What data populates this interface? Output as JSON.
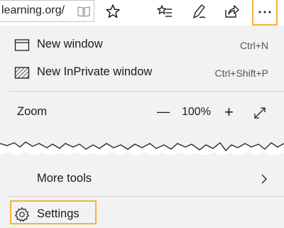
{
  "toolbar": {
    "address_text": "learning.org/",
    "icons": [
      "reading-view-icon",
      "favorite-star-icon",
      "favorites-list-icon",
      "pen-icon",
      "share-icon",
      "more-actions-icon"
    ]
  },
  "menu": {
    "new_window": {
      "label": "New window",
      "shortcut": "Ctrl+N"
    },
    "new_inprivate": {
      "label": "New InPrivate window",
      "shortcut": "Ctrl+Shift+P"
    },
    "zoom": {
      "label": "Zoom",
      "minus": "—",
      "value": "100%",
      "plus": "+"
    },
    "more_tools": {
      "label": "More tools"
    },
    "settings": {
      "label": "Settings"
    }
  },
  "colors": {
    "highlight": "#f4b23b",
    "menu_bg": "#f2f2f2"
  }
}
